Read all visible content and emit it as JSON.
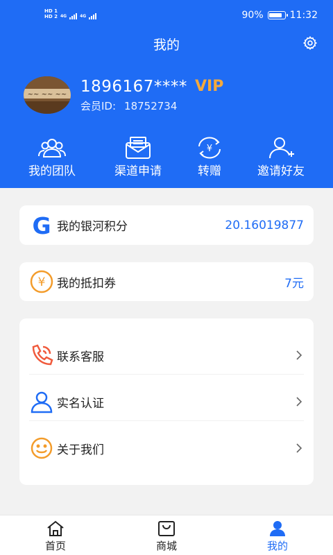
{
  "status_bar": {
    "sim1": "HD 1",
    "sim2": "HD 2",
    "net1": "4G",
    "net2": "4G",
    "battery_pct": "90%",
    "battery_level": 0.9,
    "time": "11:32"
  },
  "header": {
    "title": "我的"
  },
  "profile": {
    "phone": "1896167****",
    "badge": "VIP",
    "member_label": "会员ID:",
    "member_id": "18752734"
  },
  "actions": [
    {
      "label": "我的团队",
      "icon": "team-icon"
    },
    {
      "label": "渠道申请",
      "icon": "channel-apply-icon"
    },
    {
      "label": "转赠",
      "icon": "transfer-gift-icon"
    },
    {
      "label": "邀请好友",
      "icon": "invite-friend-icon"
    }
  ],
  "points": {
    "label": "我的银河积分",
    "value": "20.16019877",
    "icon": "galaxy-g-icon"
  },
  "voucher": {
    "label": "我的抵扣券",
    "value": "7元",
    "icon": "yuan-coupon-icon"
  },
  "menu": [
    {
      "label": "联系客服",
      "icon": "customer-service-phone-icon"
    },
    {
      "label": "实名认证",
      "icon": "identity-verify-icon"
    },
    {
      "label": "关于我们",
      "icon": "smiley-about-icon"
    }
  ],
  "tabbar": [
    {
      "label": "首页",
      "icon": "home-icon"
    },
    {
      "label": "商城",
      "icon": "shop-bag-icon"
    },
    {
      "label": "我的",
      "icon": "profile-icon"
    }
  ],
  "colors": {
    "primary": "#1f6cf5",
    "vip": "#f5a93c",
    "icon_orange": "#f39c2b",
    "icon_red": "#f05a3c",
    "background": "#f2f2f2"
  }
}
